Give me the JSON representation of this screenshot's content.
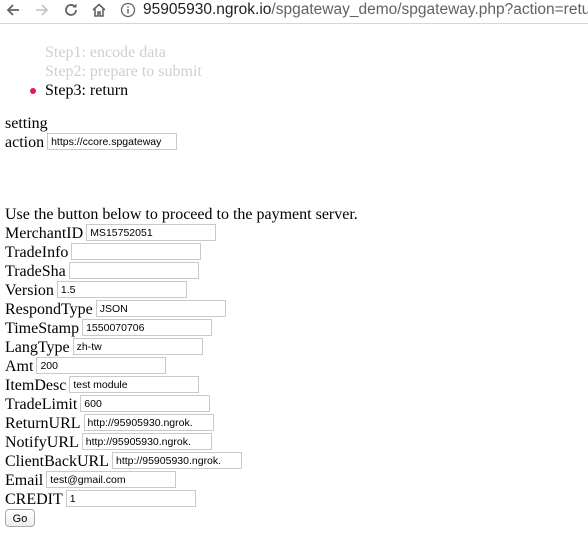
{
  "browser": {
    "url_host": "95905930.ngrok.io",
    "url_path": "/spgateway_demo/spgateway.php?action=return"
  },
  "steps": [
    {
      "label": "Step1: encode data",
      "active": false
    },
    {
      "label": "Step2: prepare to submit",
      "active": false
    },
    {
      "label": "Step3: return",
      "active": true
    }
  ],
  "setting": {
    "title": "setting",
    "action_label": "action",
    "action_value": "https://ccore.spgateway"
  },
  "intro": "Use the button below to proceed to the payment server.",
  "fields": {
    "merchant_id": {
      "label": "MerchantID",
      "value": "MS15752051"
    },
    "trade_info": {
      "label": "TradeInfo",
      "value": ""
    },
    "trade_sha": {
      "label": "TradeSha",
      "value": ""
    },
    "version": {
      "label": "Version",
      "value": "1.5"
    },
    "respond_type": {
      "label": "RespondType",
      "value": "JSON"
    },
    "time_stamp": {
      "label": "TimeStamp",
      "value": "1550070706"
    },
    "lang_type": {
      "label": "LangType",
      "value": "zh-tw"
    },
    "amt": {
      "label": "Amt",
      "value": "200"
    },
    "item_desc": {
      "label": "ItemDesc",
      "value": "test module"
    },
    "trade_limit": {
      "label": "TradeLimit",
      "value": "600"
    },
    "return_url": {
      "label": "ReturnURL",
      "value": "http://95905930.ngrok."
    },
    "notify_url": {
      "label": "NotifyURL",
      "value": "http://95905930.ngrok."
    },
    "client_back_url": {
      "label": "ClientBackURL",
      "value": "http://95905930.ngrok."
    },
    "email": {
      "label": "Email",
      "value": "test@gmail.com"
    },
    "credit": {
      "label": "CREDIT",
      "value": "1"
    }
  },
  "submit_label": "Go",
  "colors": {
    "bullet": "#e8175d",
    "dim_text": "#cfcfcf"
  },
  "icons": [
    "back-arrow-icon",
    "forward-arrow-icon",
    "reload-icon",
    "home-icon",
    "info-icon"
  ]
}
